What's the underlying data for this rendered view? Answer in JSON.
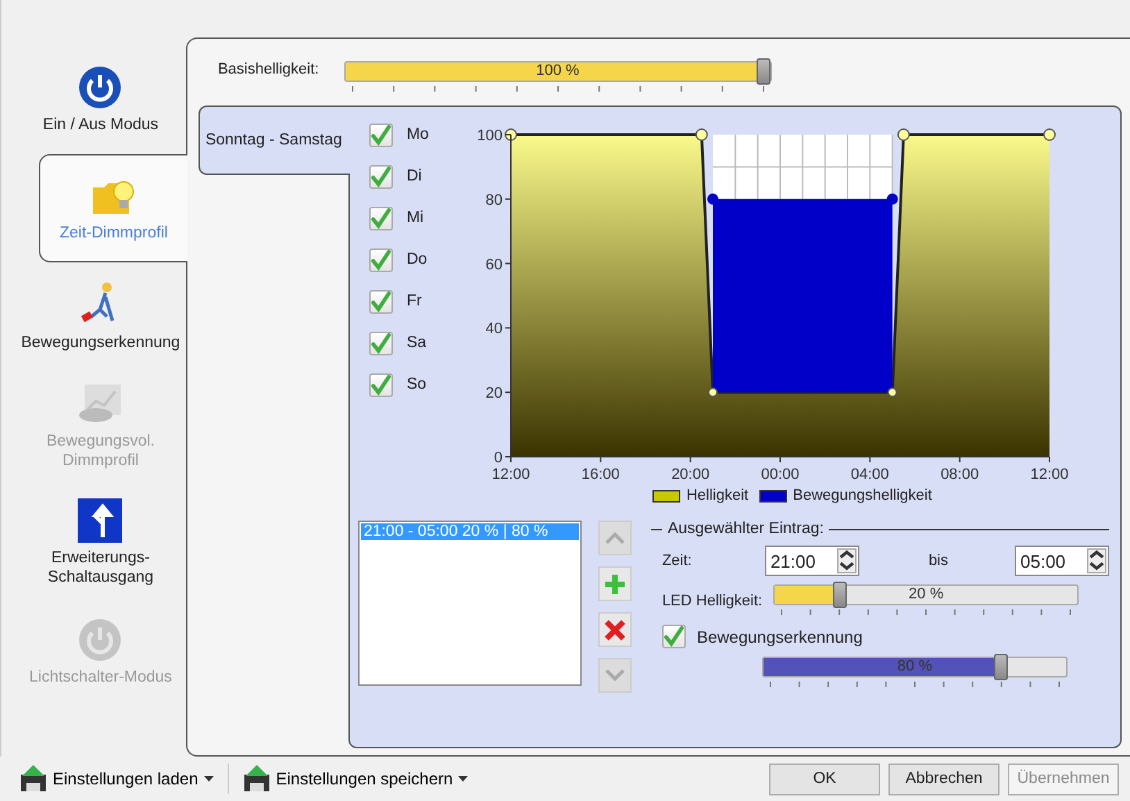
{
  "sidebar": {
    "items": [
      {
        "label": "Ein / Aus Modus",
        "selected": false,
        "disabled": false
      },
      {
        "label": "Zeit-Dimmprofil",
        "selected": true,
        "disabled": false
      },
      {
        "label": "Bewegungserkennung",
        "selected": false,
        "disabled": false
      },
      {
        "label": "Bewegungsvol. Dimmprofil",
        "selected": false,
        "disabled": true
      },
      {
        "label": "Erweiterungs- Schaltausgang",
        "selected": false,
        "disabled": false
      },
      {
        "label": "Lichtschalter-Modus",
        "selected": false,
        "disabled": true
      }
    ]
  },
  "base_brightness": {
    "label": "Basishelligkeit:",
    "level": 1.0,
    "reading": "100 %"
  },
  "day_tabs": [
    {
      "label": "Sonntag - Samstag",
      "selected": true
    }
  ],
  "days": [
    {
      "label": "Mo",
      "checked": true
    },
    {
      "label": "Di",
      "checked": true
    },
    {
      "label": "Mi",
      "checked": true
    },
    {
      "label": "Do",
      "checked": true
    },
    {
      "label": "Fr",
      "checked": true
    },
    {
      "label": "Sa",
      "checked": true
    },
    {
      "label": "So",
      "checked": true
    }
  ],
  "chart_data": {
    "type": "area",
    "categories": [
      "12:00",
      null,
      null,
      null,
      null,
      null,
      null,
      null,
      "16:00",
      null,
      null,
      null,
      null,
      null,
      null,
      null,
      "20:00",
      null,
      null,
      null,
      null,
      null,
      null,
      null,
      "00:00",
      null,
      null,
      null,
      null,
      null,
      null,
      null,
      "04:00",
      null,
      null,
      null,
      null,
      null,
      null,
      null,
      "08:00",
      null,
      null,
      null,
      null,
      null,
      null,
      null,
      "12:00"
    ],
    "ylim": [
      0,
      100
    ],
    "yticks": [
      0,
      20,
      40,
      60,
      80,
      100
    ],
    "series": [
      {
        "name": "Helligkeit",
        "color": "#c8c800",
        "values": [
          100,
          100,
          100,
          100,
          100,
          100,
          100,
          100,
          100,
          100,
          100,
          100,
          100,
          100,
          100,
          100,
          100,
          100,
          20,
          20,
          20,
          20,
          20,
          20,
          20,
          20,
          20,
          20,
          20,
          20,
          20,
          20,
          20,
          20,
          20,
          100,
          100,
          100,
          100,
          100,
          100,
          100,
          100,
          100,
          100,
          100,
          100,
          100,
          100
        ]
      },
      {
        "name": "Bewegungshelligkeit",
        "color": "#0000c8",
        "values": [
          null,
          null,
          null,
          null,
          null,
          null,
          null,
          null,
          null,
          null,
          null,
          null,
          null,
          null,
          null,
          null,
          null,
          null,
          80,
          80,
          80,
          80,
          80,
          80,
          80,
          80,
          80,
          80,
          80,
          80,
          80,
          80,
          80,
          80,
          80,
          null,
          null,
          null,
          null,
          null,
          null,
          null,
          null,
          null,
          null,
          null,
          null,
          null,
          null
        ]
      }
    ]
  },
  "entries": [
    {
      "label": "21:00 - 05:00  20 % | 80 %",
      "selected": true
    }
  ],
  "entry_buttons": [
    {
      "kind": "up",
      "disabled": true
    },
    {
      "kind": "add",
      "disabled": false
    },
    {
      "kind": "delete",
      "disabled": false
    },
    {
      "kind": "down",
      "disabled": true
    }
  ],
  "selected_entry": {
    "title": "Ausgewählter Eintrag:",
    "time_label": "Zeit:",
    "from": "21:00",
    "to_label": "bis",
    "to": "05:00",
    "led": {
      "label": "LED Helligkeit:",
      "level": 0.2,
      "reading": "20 %"
    },
    "motion": {
      "label": "Bewegungserkennung",
      "checked": true,
      "level": 0.8,
      "reading": "80 %"
    }
  },
  "footer": {
    "menus": [
      "Einstellungen laden",
      "Einstellungen speichern"
    ],
    "buttons": [
      {
        "label": "OK",
        "disabled": false
      },
      {
        "label": "Abbrechen",
        "disabled": false
      },
      {
        "label": "Übernehmen",
        "disabled": true
      }
    ]
  }
}
